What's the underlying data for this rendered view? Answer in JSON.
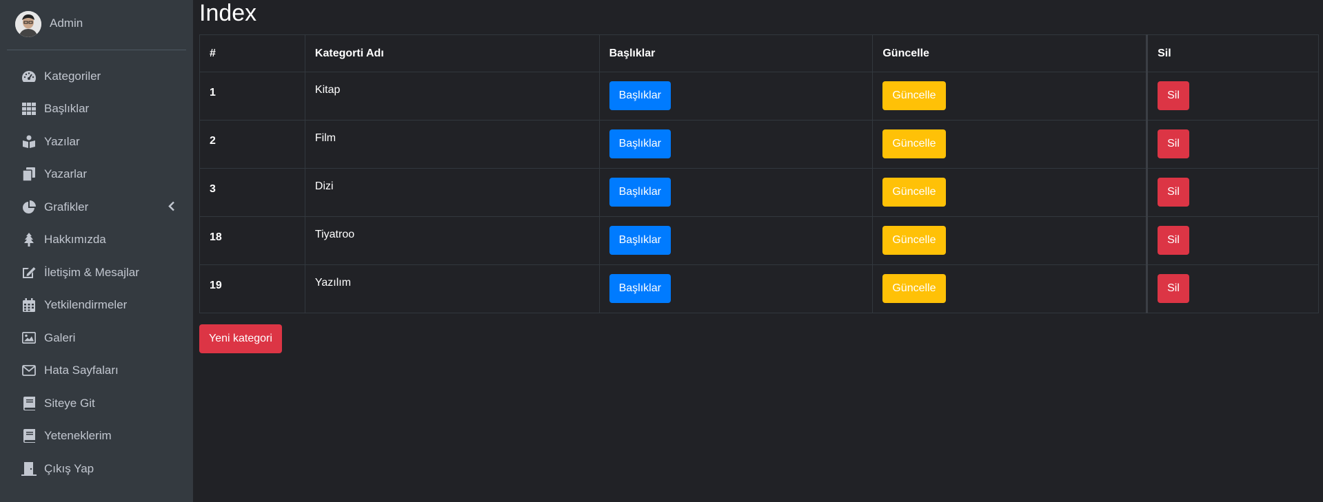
{
  "user": {
    "name": "Admin"
  },
  "sidebar": {
    "items": [
      {
        "label": "Kategoriler",
        "icon": "dashboard-gauge-icon"
      },
      {
        "label": "Başlıklar",
        "icon": "grid-icon"
      },
      {
        "label": "Yazılar",
        "icon": "book-reader-icon"
      },
      {
        "label": "Yazarlar",
        "icon": "copy-icon"
      },
      {
        "label": "Grafikler",
        "icon": "pie-chart-icon",
        "has_submenu": true
      },
      {
        "label": "Hakkımızda",
        "icon": "tree-icon"
      },
      {
        "label": "İletişim & Mesajlar",
        "icon": "edit-icon"
      },
      {
        "label": "Yetkilendirmeler",
        "icon": "calendar-icon"
      },
      {
        "label": "Galeri",
        "icon": "image-icon"
      },
      {
        "label": "Hata Sayfaları",
        "icon": "envelope-icon"
      },
      {
        "label": "Siteye Git",
        "icon": "book-icon"
      },
      {
        "label": "Yeteneklerim",
        "icon": "book-icon"
      },
      {
        "label": "Çıkış Yap",
        "icon": "door-exit-icon"
      }
    ]
  },
  "page": {
    "title": "Index"
  },
  "table": {
    "headers": [
      "#",
      "Kategorti Adı",
      "Başlıklar",
      "Güncelle",
      "Sil"
    ],
    "rows": [
      {
        "id": "1",
        "name": "Kitap",
        "b1": "Başlıklar",
        "b2": "Güncelle",
        "b3": "Sil"
      },
      {
        "id": "2",
        "name": "Film",
        "b1": "Başlıklar",
        "b2": "Güncelle",
        "b3": "Sil"
      },
      {
        "id": "3",
        "name": "Dizi",
        "b1": "Başlıklar",
        "b2": "Güncelle",
        "b3": "Sil"
      },
      {
        "id": "18",
        "name": "Tiyatroo",
        "b1": "Başlıklar",
        "b2": "Güncelle",
        "b3": "Sil"
      },
      {
        "id": "19",
        "name": "Yazılım",
        "b1": "Başlıklar",
        "b2": "Güncelle",
        "b3": "Sil"
      }
    ]
  },
  "actions": {
    "new_category": "Yeni kategori"
  },
  "colors": {
    "sidebar_bg": "#343a40",
    "content_bg": "#212226",
    "primary": "#007bff",
    "warning": "#ffc107",
    "danger": "#dc3545"
  }
}
